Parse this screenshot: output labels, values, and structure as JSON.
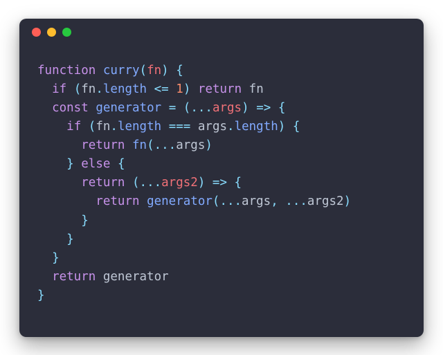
{
  "code": {
    "tokens": [
      [
        {
          "t": "function",
          "c": "kw"
        },
        {
          "t": " ",
          "c": ""
        },
        {
          "t": "curry",
          "c": "fn"
        },
        {
          "t": "(",
          "c": "op"
        },
        {
          "t": "fn",
          "c": "arg"
        },
        {
          "t": ")",
          "c": "op"
        },
        {
          "t": " ",
          "c": ""
        },
        {
          "t": "{",
          "c": "op"
        }
      ],
      [
        {
          "t": "  ",
          "c": ""
        },
        {
          "t": "if",
          "c": "kw"
        },
        {
          "t": " ",
          "c": ""
        },
        {
          "t": "(",
          "c": "op"
        },
        {
          "t": "fn",
          "c": "id"
        },
        {
          "t": ".",
          "c": "op"
        },
        {
          "t": "length",
          "c": "prop"
        },
        {
          "t": " ",
          "c": ""
        },
        {
          "t": "<=",
          "c": "op"
        },
        {
          "t": " ",
          "c": ""
        },
        {
          "t": "1",
          "c": "num"
        },
        {
          "t": ")",
          "c": "op"
        },
        {
          "t": " ",
          "c": ""
        },
        {
          "t": "return",
          "c": "kw"
        },
        {
          "t": " ",
          "c": ""
        },
        {
          "t": "fn",
          "c": "id"
        }
      ],
      [
        {
          "t": "  ",
          "c": ""
        },
        {
          "t": "const",
          "c": "kw"
        },
        {
          "t": " ",
          "c": ""
        },
        {
          "t": "generator",
          "c": "fn"
        },
        {
          "t": " ",
          "c": ""
        },
        {
          "t": "=",
          "c": "op"
        },
        {
          "t": " ",
          "c": ""
        },
        {
          "t": "(",
          "c": "op"
        },
        {
          "t": "...",
          "c": "op"
        },
        {
          "t": "args",
          "c": "arg"
        },
        {
          "t": ")",
          "c": "op"
        },
        {
          "t": " ",
          "c": ""
        },
        {
          "t": "=>",
          "c": "op"
        },
        {
          "t": " ",
          "c": ""
        },
        {
          "t": "{",
          "c": "op"
        }
      ],
      [
        {
          "t": "    ",
          "c": ""
        },
        {
          "t": "if",
          "c": "kw"
        },
        {
          "t": " ",
          "c": ""
        },
        {
          "t": "(",
          "c": "op"
        },
        {
          "t": "fn",
          "c": "id"
        },
        {
          "t": ".",
          "c": "op"
        },
        {
          "t": "length",
          "c": "prop"
        },
        {
          "t": " ",
          "c": ""
        },
        {
          "t": "===",
          "c": "op"
        },
        {
          "t": " ",
          "c": ""
        },
        {
          "t": "args",
          "c": "id"
        },
        {
          "t": ".",
          "c": "op"
        },
        {
          "t": "length",
          "c": "prop"
        },
        {
          "t": ")",
          "c": "op"
        },
        {
          "t": " ",
          "c": ""
        },
        {
          "t": "{",
          "c": "op"
        }
      ],
      [
        {
          "t": "      ",
          "c": ""
        },
        {
          "t": "return",
          "c": "kw"
        },
        {
          "t": " ",
          "c": ""
        },
        {
          "t": "fn",
          "c": "fn"
        },
        {
          "t": "(",
          "c": "op"
        },
        {
          "t": "...",
          "c": "op"
        },
        {
          "t": "args",
          "c": "id"
        },
        {
          "t": ")",
          "c": "op"
        }
      ],
      [
        {
          "t": "    ",
          "c": ""
        },
        {
          "t": "}",
          "c": "op"
        },
        {
          "t": " ",
          "c": ""
        },
        {
          "t": "else",
          "c": "kw"
        },
        {
          "t": " ",
          "c": ""
        },
        {
          "t": "{",
          "c": "op"
        }
      ],
      [
        {
          "t": "      ",
          "c": ""
        },
        {
          "t": "return",
          "c": "kw"
        },
        {
          "t": " ",
          "c": ""
        },
        {
          "t": "(",
          "c": "op"
        },
        {
          "t": "...",
          "c": "op"
        },
        {
          "t": "args2",
          "c": "arg"
        },
        {
          "t": ")",
          "c": "op"
        },
        {
          "t": " ",
          "c": ""
        },
        {
          "t": "=>",
          "c": "op"
        },
        {
          "t": " ",
          "c": ""
        },
        {
          "t": "{",
          "c": "op"
        }
      ],
      [
        {
          "t": "        ",
          "c": ""
        },
        {
          "t": "return",
          "c": "kw"
        },
        {
          "t": " ",
          "c": ""
        },
        {
          "t": "generator",
          "c": "fn"
        },
        {
          "t": "(",
          "c": "op"
        },
        {
          "t": "...",
          "c": "op"
        },
        {
          "t": "args",
          "c": "id"
        },
        {
          "t": ",",
          "c": "op"
        },
        {
          "t": " ",
          "c": ""
        },
        {
          "t": "...",
          "c": "op"
        },
        {
          "t": "args2",
          "c": "id"
        },
        {
          "t": ")",
          "c": "op"
        }
      ],
      [
        {
          "t": "      ",
          "c": ""
        },
        {
          "t": "}",
          "c": "op"
        }
      ],
      [
        {
          "t": "    ",
          "c": ""
        },
        {
          "t": "}",
          "c": "op"
        }
      ],
      [
        {
          "t": "  ",
          "c": ""
        },
        {
          "t": "}",
          "c": "op"
        }
      ],
      [
        {
          "t": "  ",
          "c": ""
        },
        {
          "t": "return",
          "c": "kw"
        },
        {
          "t": " ",
          "c": ""
        },
        {
          "t": "generator",
          "c": "id"
        }
      ],
      [
        {
          "t": "}",
          "c": "op"
        }
      ]
    ]
  }
}
